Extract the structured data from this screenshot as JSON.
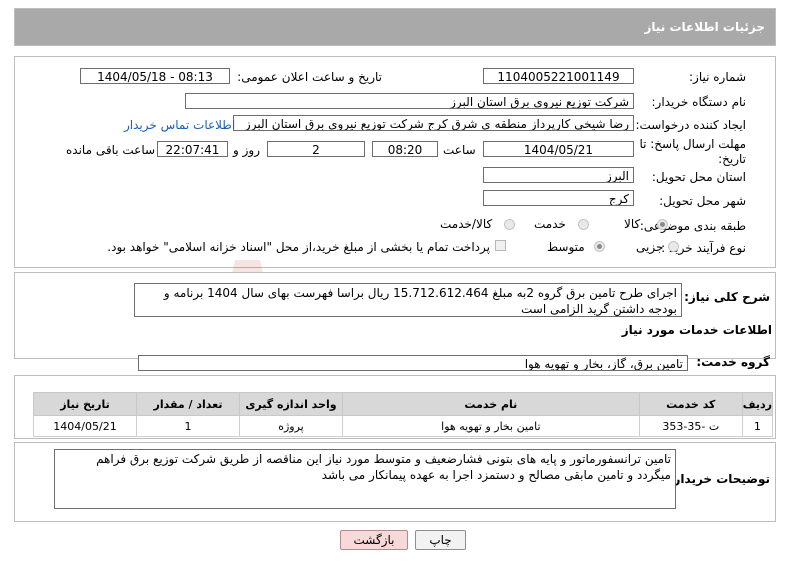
{
  "header": {
    "title": "جزئیات اطلاعات نیاز"
  },
  "fields": {
    "need_number_label": "شماره نیاز:",
    "need_number": "1104005221001149",
    "announce_label": "تاریخ و ساعت اعلان عمومی:",
    "announce_value": "1404/05/18 - 08:13",
    "buyer_org_label": "نام دستگاه خریدار:",
    "buyer_org": "شرکت توزیع نیروی برق استان البرز",
    "requester_label": "ایجاد کننده درخواست:",
    "requester": "رضا شیخی کارپرداز منطقه ی شرق کرج شرکت توزیع نیروی برق استان البرز",
    "contact_link": "اطلاعات تماس خریدار",
    "deadline_label_1": "مهلت ارسال پاسخ: تا",
    "deadline_label_2": "تاریخ:",
    "deadline_date": "1404/05/21",
    "time_label": "ساعت",
    "deadline_time": "08:20",
    "days_count": "2",
    "days_label": "روز و",
    "remaining_time": "22:07:41",
    "remaining_label": "ساعت باقی مانده",
    "province_label": "استان محل تحویل:",
    "province": "البرز",
    "city_label": "شهر محل تحویل:",
    "city": "کرج",
    "category_label": "طبقه بندی موضوعی:",
    "category_options": [
      "کالا",
      "خدمت",
      "کالا/خدمت"
    ],
    "process_label": "نوع فرآیند خرید :",
    "process_options": [
      "جزیی",
      "متوسط"
    ],
    "payment_note": "پرداخت تمام یا بخشی از مبلغ خرید،از محل \"اسناد خزانه اسلامی\" خواهد بود."
  },
  "summary": {
    "label": "شرح کلی نیاز:",
    "text": "اجرای طرح تامین برق گروه 2به مبلغ 15.712.612.464 ریال براسا فهرست بهای سال 1404 برنامه و بودجه داشتن گرید الزامی است"
  },
  "services": {
    "section_title": "اطلاعات خدمات مورد نیاز",
    "group_label": "گروه خدمت:",
    "group_value": "تامین برق، گاز، بخار و تهویه هوا",
    "columns": [
      "ردیف",
      "کد خدمت",
      "نام خدمت",
      "واحد اندازه گیری",
      "تعداد / مقدار",
      "تاریخ نیاز"
    ],
    "rows": [
      [
        "1",
        "ت -35-353",
        "تامین بخار و تهویه هوا",
        "پروژه",
        "1",
        "1404/05/21"
      ]
    ]
  },
  "buyer_notes": {
    "label": "توضیحات خریدار:",
    "text": "تامین ترانسفورماتور و پایه های بتونی فشارضعیف و متوسط مورد نیاز این مناقصه از طریق شرکت توزیع برق فراهم میگردد و تامین مابقی مصالح و دستمزد اجرا به عهده پیمانکار می باشد"
  },
  "buttons": {
    "print": "چاپ",
    "back": "بازگشت"
  },
  "watermark_text": "AriaTender.neT",
  "colors": {
    "header_bg": "#a9a9a9",
    "link": "#1a5fb4",
    "back_btn": "#f7d9d9",
    "watermark": "#c0392b"
  }
}
